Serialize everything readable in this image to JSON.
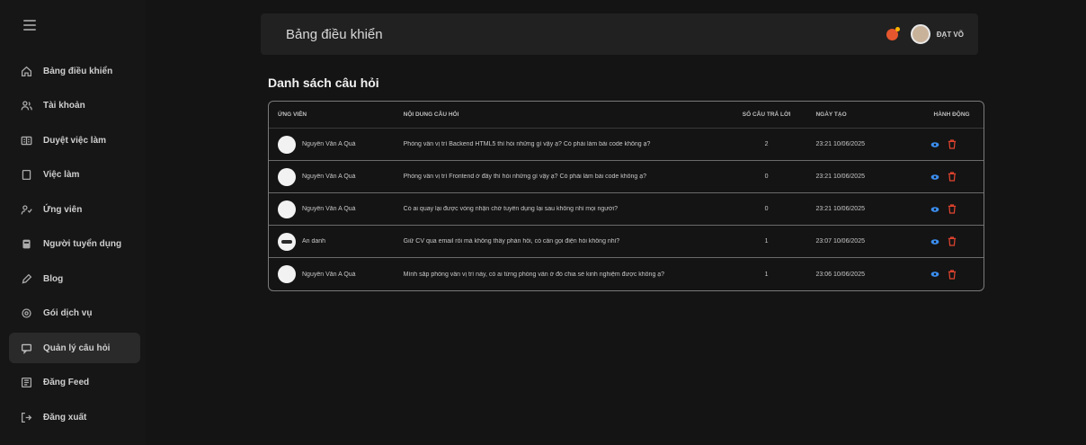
{
  "sidebar": {
    "items": [
      {
        "label": "Bảng điều khiển",
        "icon": "home-icon",
        "active": false
      },
      {
        "label": "Tài khoản",
        "icon": "users-icon",
        "active": false
      },
      {
        "label": "Duyệt việc làm",
        "icon": "briefcase-check-icon",
        "active": false
      },
      {
        "label": "Việc làm",
        "icon": "document-icon",
        "active": false
      },
      {
        "label": "Ứng viên",
        "icon": "candidates-icon",
        "active": false
      },
      {
        "label": "Người tuyển dụng",
        "icon": "recruiter-icon",
        "active": false
      },
      {
        "label": "Blog",
        "icon": "pen-icon",
        "active": false
      },
      {
        "label": "Gói dịch vụ",
        "icon": "package-icon",
        "active": false
      },
      {
        "label": "Quản lý câu hỏi",
        "icon": "chat-icon",
        "active": true
      },
      {
        "label": "Đăng Feed",
        "icon": "feed-icon",
        "active": false
      },
      {
        "label": "Đăng xuất",
        "icon": "logout-icon",
        "active": false
      }
    ]
  },
  "header": {
    "title": "Bảng điều khiển",
    "user_name": "ĐẠT VÕ"
  },
  "main": {
    "title": "Danh sách câu hỏi",
    "table": {
      "columns": [
        "Ứng viên",
        "Nội dung câu hỏi",
        "Số câu trả lời",
        "Ngày tạo",
        "Hành động"
      ],
      "rows": [
        {
          "candidate": "Nguyễn Văn A Quá",
          "avatar": "light",
          "question": "Phỏng vấn vị trí Backend HTML5 thì hỏi những gì vậy ạ? Có phải làm bài code không ạ?",
          "answers": "2",
          "created": "23:21 10/06/2025"
        },
        {
          "candidate": "Nguyễn Văn A Quá",
          "avatar": "light",
          "question": "Phỏng vấn vị trí Frontend ở đây thì hỏi những gì vậy ạ? Có phải làm bài code không ạ?",
          "answers": "0",
          "created": "23:21 10/06/2025"
        },
        {
          "candidate": "Nguyễn Văn A Quá",
          "avatar": "light",
          "question": "Có ai quay lại được vòng nhận chờ tuyển dụng lại sau không nhỉ mọi người?",
          "answers": "0",
          "created": "23:21 10/06/2025"
        },
        {
          "candidate": "Ẩn danh",
          "avatar": "dark",
          "question": "Giữ CV qua email rồi mà không thấy phản hồi, có cần gọi điện hỏi không nhỉ?",
          "answers": "1",
          "created": "23:07 10/06/2025"
        },
        {
          "candidate": "Nguyễn Văn A Quá",
          "avatar": "light",
          "question": "Mình sắp phỏng vấn vị trí này, có ai từng phỏng vấn ở đó chia sẻ kinh nghiệm được không ạ?",
          "answers": "1",
          "created": "23:06 10/06/2025"
        }
      ]
    }
  },
  "colors": {
    "background": "#141414",
    "sidebar": "#161616",
    "header": "#212121",
    "view_icon": "#3b8ef0",
    "delete_icon": "#e0432f",
    "notification": "#e4572e"
  }
}
